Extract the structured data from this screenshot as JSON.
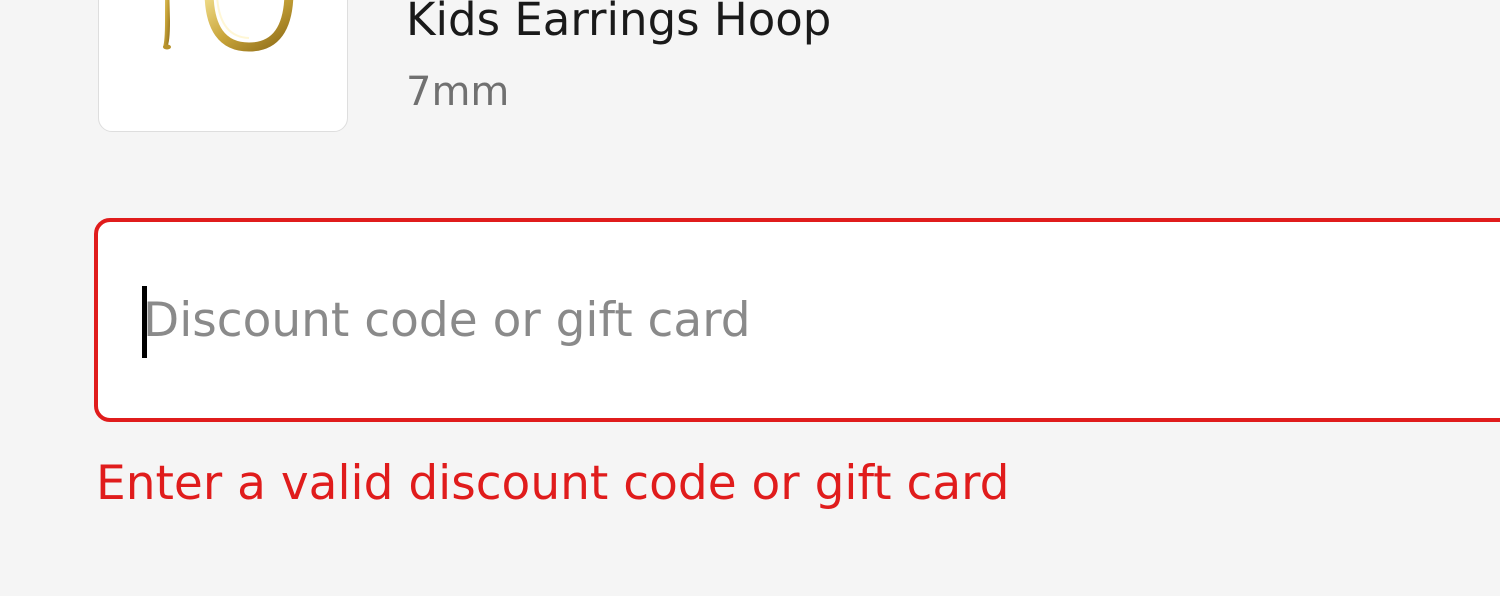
{
  "line_item": {
    "thumbnail_icon": "earring-hoop-image",
    "name": "Kids Earrings Hoop",
    "variant": "7mm"
  },
  "discount": {
    "placeholder": "Discount code or gift card",
    "value": "",
    "error": "Enter a valid discount code or gift card"
  },
  "colors": {
    "error": "#e01c1c",
    "background": "#f5f5f5",
    "gold": "#d4b24a"
  }
}
